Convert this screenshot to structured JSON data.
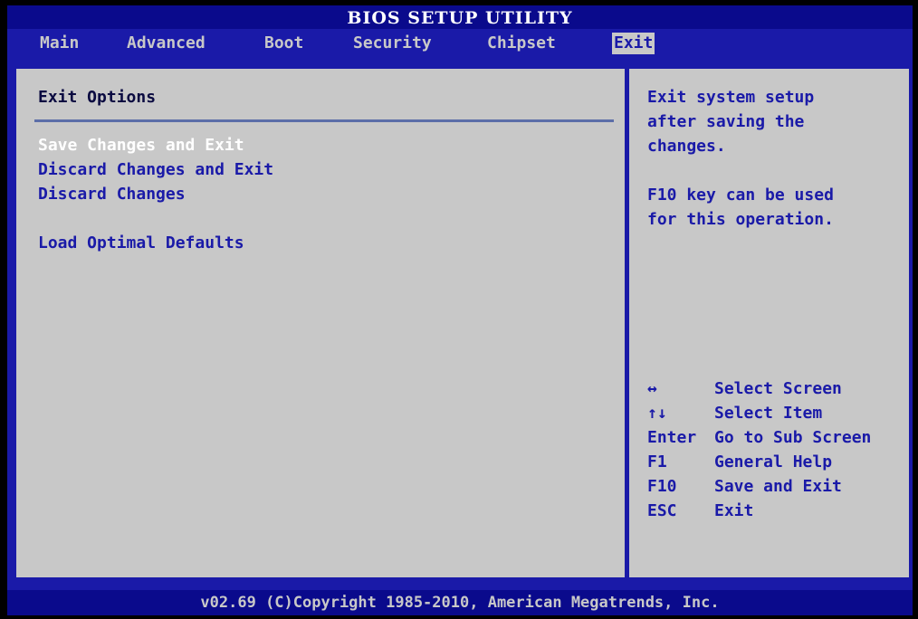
{
  "title": "BIOS SETUP UTILITY",
  "menu": [
    {
      "label": "Main"
    },
    {
      "label": "Advanced"
    },
    {
      "label": "Boot"
    },
    {
      "label": "Security"
    },
    {
      "label": "Chipset"
    },
    {
      "label": "Exit",
      "active": true
    }
  ],
  "left": {
    "section_title": "Exit Options",
    "options": [
      {
        "label": "Save Changes and Exit",
        "selected": true
      },
      {
        "label": "Discard Changes and Exit"
      },
      {
        "label": "Discard Changes"
      },
      {
        "label": "Load Optimal Defaults"
      }
    ]
  },
  "help": {
    "description": "Exit system setup\nafter saving the\nchanges.",
    "note": "F10 key can be used\nfor this operation."
  },
  "keys": [
    {
      "key": "↔",
      "desc": "Select Screen"
    },
    {
      "key": "↑↓",
      "desc": "Select Item"
    },
    {
      "key": "Enter",
      "desc": "Go to Sub Screen"
    },
    {
      "key": "F1",
      "desc": "General Help"
    },
    {
      "key": "F10",
      "desc": "Save and Exit"
    },
    {
      "key": "ESC",
      "desc": "Exit"
    }
  ],
  "footer": "v02.69 (C)Copyright 1985-2010, American Megatrends, Inc.",
  "colors": {
    "background_blue": "#1a1aa8",
    "title_blue": "#0a0a8c",
    "panel_gray": "#c8c8c8",
    "selected_text": "#ffffff"
  }
}
